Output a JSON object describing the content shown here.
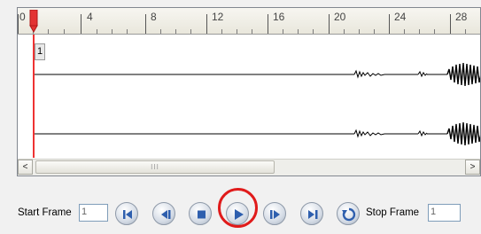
{
  "ruler": {
    "labels": [
      "0",
      "4",
      "8",
      "12",
      "16",
      "20",
      "24",
      "28"
    ]
  },
  "tracks": {
    "frame_marker": "1"
  },
  "scrollbar": {
    "left_arrow": "<",
    "right_arrow": ">",
    "thumb_grip": "III"
  },
  "controls": {
    "start_frame_label": "Start Frame",
    "start_frame_value": "1",
    "stop_frame_label": "Stop Frame",
    "stop_frame_value": "1",
    "buttons": [
      "first-frame",
      "previous-frame",
      "stop",
      "play",
      "next-frame",
      "last-frame",
      "loop"
    ]
  },
  "colors": {
    "playhead": "#e33333",
    "highlight": "#e01b1b",
    "button_icon": "#2e5fae"
  }
}
